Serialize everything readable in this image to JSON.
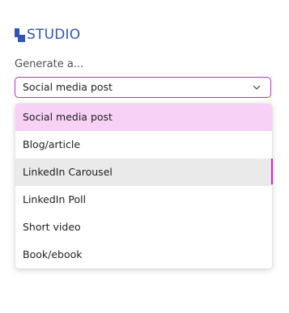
{
  "brand": {
    "name": "STUDIO",
    "icon": "studio-logo-icon",
    "color": "#2f55b8"
  },
  "generate_label": "Generate a...",
  "select": {
    "value": "Social media post",
    "icon": "chevron-down-icon",
    "border_color": "#d61fd6"
  },
  "dropdown": {
    "options": [
      {
        "label": "Social media post",
        "state": "selected"
      },
      {
        "label": "Blog/article",
        "state": ""
      },
      {
        "label": "LinkedIn Carousel",
        "state": "hovered"
      },
      {
        "label": "LinkedIn Poll",
        "state": ""
      },
      {
        "label": "Short video",
        "state": ""
      },
      {
        "label": "Book/ebook",
        "state": ""
      }
    ],
    "selected_color": "#f7d2f6",
    "hover_color": "#eaeaea"
  }
}
